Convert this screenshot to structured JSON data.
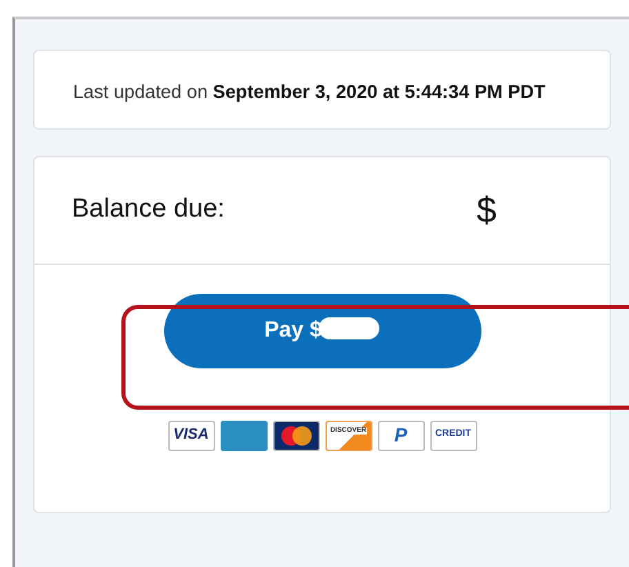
{
  "last_updated": "Last updated on **September 3, 2020 at 5:44:34 PM PDT**",
  "balance": {
    "label": "Balance due:",
    "currency": "$"
  },
  "pay_button": {
    "label": "Pay $"
  },
  "card_logos": [
    {
      "kind": "visa",
      "text": "VISA"
    },
    {
      "kind": "amex"
    },
    {
      "kind": "mastercard"
    },
    {
      "kind": "discover",
      "text": "DISCOVER"
    },
    {
      "kind": "paypal",
      "text": "P"
    },
    {
      "kind": "credit",
      "text": "CREDIT"
    }
  ]
}
